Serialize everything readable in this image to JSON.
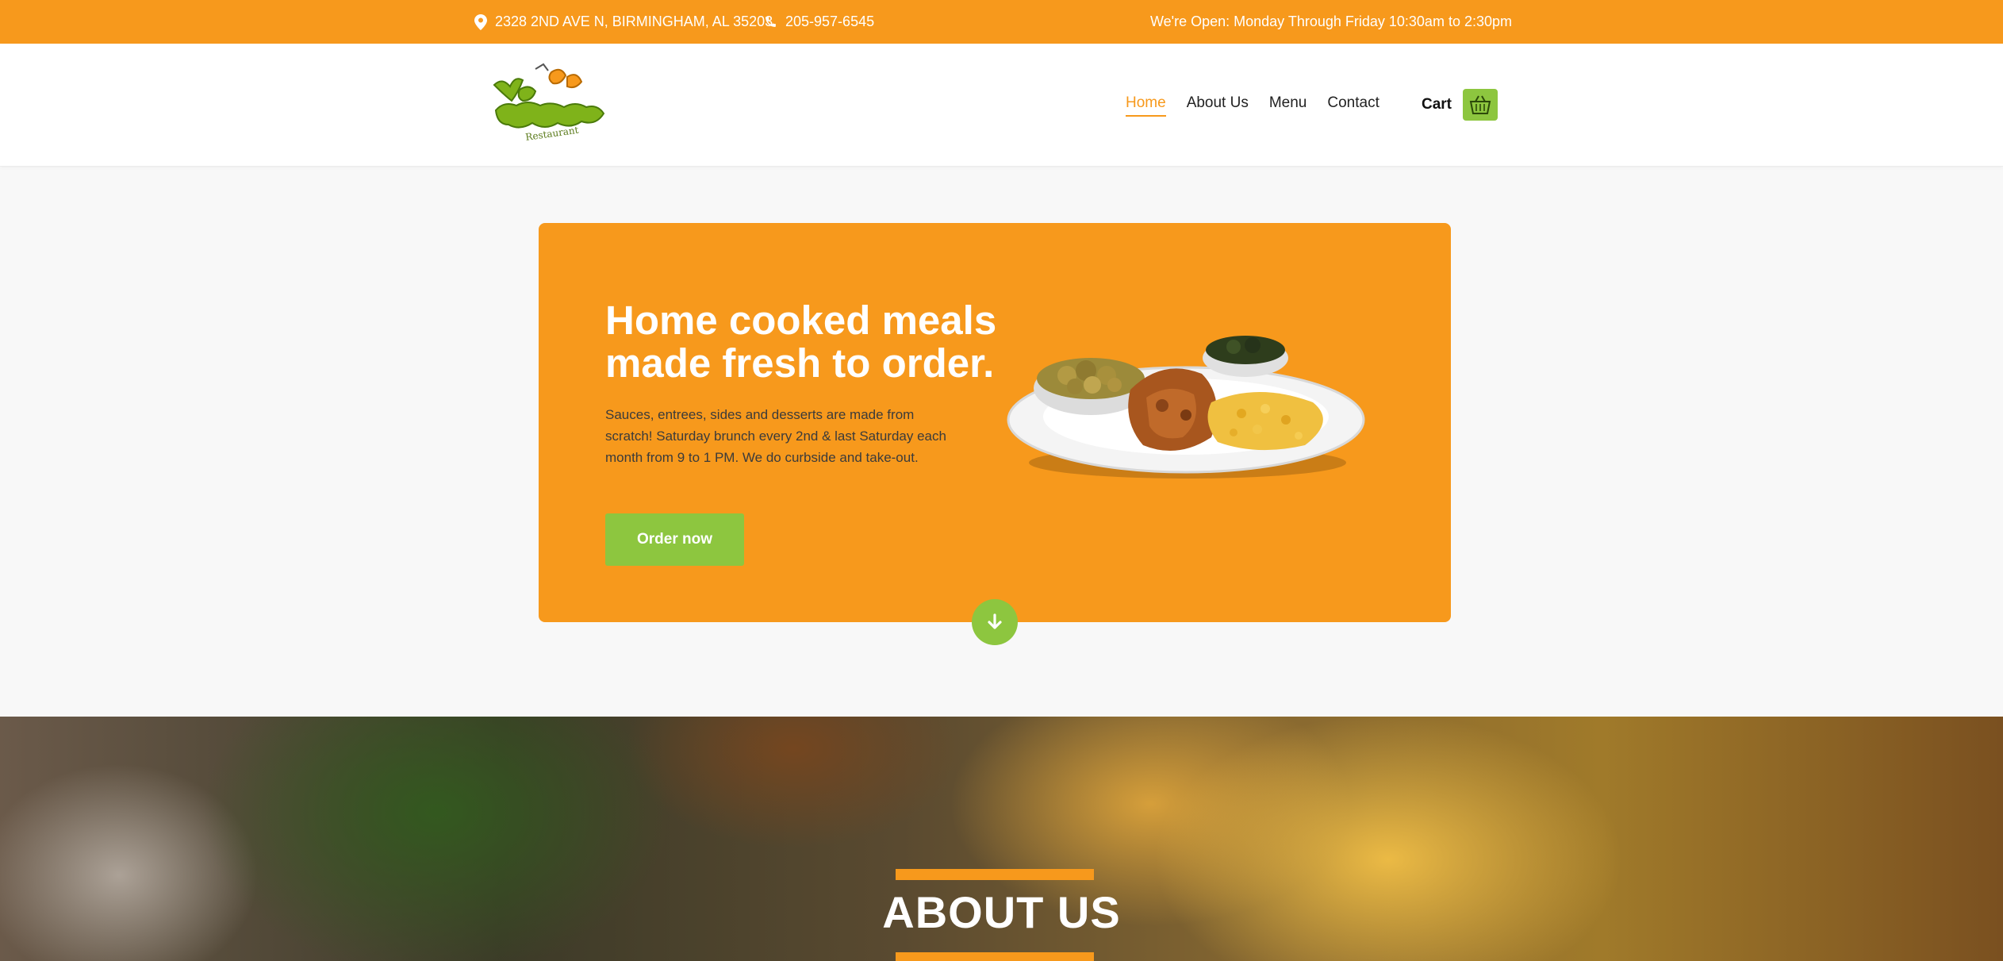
{
  "topbar": {
    "address": "2328 2ND AVE N, BIRMINGHAM, AL 35203",
    "phone": "205-957-6545",
    "hours": "We're Open: Monday Through Friday 10:30am to 2:30pm"
  },
  "header": {
    "logo_text": "Yo' Mama's Restaurant",
    "nav": [
      "Home",
      "About Us",
      "Menu",
      "Contact"
    ],
    "cart_label": "Cart"
  },
  "hero": {
    "title": "Home cooked meals made fresh to order.",
    "text": "Sauces, entrees, sides and desserts are made from scratch! Saturday brunch every 2nd & last Saturday each month from 9 to 1 PM. We do curbside and take-out.",
    "button": "Order now"
  },
  "about": {
    "title": "ABOUT US"
  },
  "colors": {
    "brand_orange": "#f7991c",
    "brand_green": "#8dc63f"
  },
  "icons": [
    "location-pin-icon",
    "phone-icon",
    "shopping-basket-icon",
    "arrow-down-icon"
  ]
}
